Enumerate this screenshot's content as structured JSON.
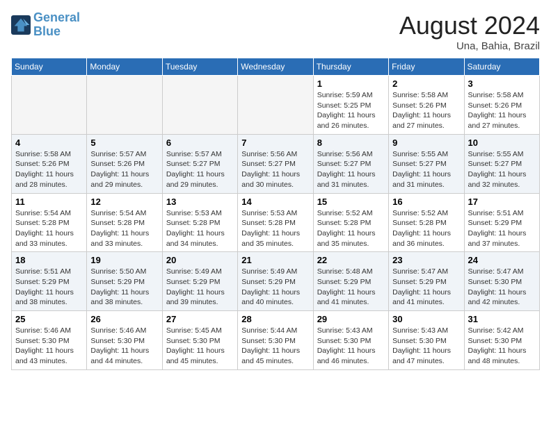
{
  "header": {
    "logo_line1": "General",
    "logo_line2": "Blue",
    "month_year": "August 2024",
    "location": "Una, Bahia, Brazil"
  },
  "days_of_week": [
    "Sunday",
    "Monday",
    "Tuesday",
    "Wednesday",
    "Thursday",
    "Friday",
    "Saturday"
  ],
  "weeks": [
    {
      "row_class": "row-odd",
      "days": [
        {
          "num": "",
          "empty": true,
          "info": ""
        },
        {
          "num": "",
          "empty": true,
          "info": ""
        },
        {
          "num": "",
          "empty": true,
          "info": ""
        },
        {
          "num": "",
          "empty": true,
          "info": ""
        },
        {
          "num": "1",
          "empty": false,
          "info": "Sunrise: 5:59 AM\nSunset: 5:25 PM\nDaylight: 11 hours\nand 26 minutes."
        },
        {
          "num": "2",
          "empty": false,
          "info": "Sunrise: 5:58 AM\nSunset: 5:26 PM\nDaylight: 11 hours\nand 27 minutes."
        },
        {
          "num": "3",
          "empty": false,
          "info": "Sunrise: 5:58 AM\nSunset: 5:26 PM\nDaylight: 11 hours\nand 27 minutes."
        }
      ]
    },
    {
      "row_class": "row-even",
      "days": [
        {
          "num": "4",
          "empty": false,
          "info": "Sunrise: 5:58 AM\nSunset: 5:26 PM\nDaylight: 11 hours\nand 28 minutes."
        },
        {
          "num": "5",
          "empty": false,
          "info": "Sunrise: 5:57 AM\nSunset: 5:26 PM\nDaylight: 11 hours\nand 29 minutes."
        },
        {
          "num": "6",
          "empty": false,
          "info": "Sunrise: 5:57 AM\nSunset: 5:27 PM\nDaylight: 11 hours\nand 29 minutes."
        },
        {
          "num": "7",
          "empty": false,
          "info": "Sunrise: 5:56 AM\nSunset: 5:27 PM\nDaylight: 11 hours\nand 30 minutes."
        },
        {
          "num": "8",
          "empty": false,
          "info": "Sunrise: 5:56 AM\nSunset: 5:27 PM\nDaylight: 11 hours\nand 31 minutes."
        },
        {
          "num": "9",
          "empty": false,
          "info": "Sunrise: 5:55 AM\nSunset: 5:27 PM\nDaylight: 11 hours\nand 31 minutes."
        },
        {
          "num": "10",
          "empty": false,
          "info": "Sunrise: 5:55 AM\nSunset: 5:27 PM\nDaylight: 11 hours\nand 32 minutes."
        }
      ]
    },
    {
      "row_class": "row-odd",
      "days": [
        {
          "num": "11",
          "empty": false,
          "info": "Sunrise: 5:54 AM\nSunset: 5:28 PM\nDaylight: 11 hours\nand 33 minutes."
        },
        {
          "num": "12",
          "empty": false,
          "info": "Sunrise: 5:54 AM\nSunset: 5:28 PM\nDaylight: 11 hours\nand 33 minutes."
        },
        {
          "num": "13",
          "empty": false,
          "info": "Sunrise: 5:53 AM\nSunset: 5:28 PM\nDaylight: 11 hours\nand 34 minutes."
        },
        {
          "num": "14",
          "empty": false,
          "info": "Sunrise: 5:53 AM\nSunset: 5:28 PM\nDaylight: 11 hours\nand 35 minutes."
        },
        {
          "num": "15",
          "empty": false,
          "info": "Sunrise: 5:52 AM\nSunset: 5:28 PM\nDaylight: 11 hours\nand 35 minutes."
        },
        {
          "num": "16",
          "empty": false,
          "info": "Sunrise: 5:52 AM\nSunset: 5:28 PM\nDaylight: 11 hours\nand 36 minutes."
        },
        {
          "num": "17",
          "empty": false,
          "info": "Sunrise: 5:51 AM\nSunset: 5:29 PM\nDaylight: 11 hours\nand 37 minutes."
        }
      ]
    },
    {
      "row_class": "row-even",
      "days": [
        {
          "num": "18",
          "empty": false,
          "info": "Sunrise: 5:51 AM\nSunset: 5:29 PM\nDaylight: 11 hours\nand 38 minutes."
        },
        {
          "num": "19",
          "empty": false,
          "info": "Sunrise: 5:50 AM\nSunset: 5:29 PM\nDaylight: 11 hours\nand 38 minutes."
        },
        {
          "num": "20",
          "empty": false,
          "info": "Sunrise: 5:49 AM\nSunset: 5:29 PM\nDaylight: 11 hours\nand 39 minutes."
        },
        {
          "num": "21",
          "empty": false,
          "info": "Sunrise: 5:49 AM\nSunset: 5:29 PM\nDaylight: 11 hours\nand 40 minutes."
        },
        {
          "num": "22",
          "empty": false,
          "info": "Sunrise: 5:48 AM\nSunset: 5:29 PM\nDaylight: 11 hours\nand 41 minutes."
        },
        {
          "num": "23",
          "empty": false,
          "info": "Sunrise: 5:47 AM\nSunset: 5:29 PM\nDaylight: 11 hours\nand 41 minutes."
        },
        {
          "num": "24",
          "empty": false,
          "info": "Sunrise: 5:47 AM\nSunset: 5:30 PM\nDaylight: 11 hours\nand 42 minutes."
        }
      ]
    },
    {
      "row_class": "row-odd",
      "days": [
        {
          "num": "25",
          "empty": false,
          "info": "Sunrise: 5:46 AM\nSunset: 5:30 PM\nDaylight: 11 hours\nand 43 minutes."
        },
        {
          "num": "26",
          "empty": false,
          "info": "Sunrise: 5:46 AM\nSunset: 5:30 PM\nDaylight: 11 hours\nand 44 minutes."
        },
        {
          "num": "27",
          "empty": false,
          "info": "Sunrise: 5:45 AM\nSunset: 5:30 PM\nDaylight: 11 hours\nand 45 minutes."
        },
        {
          "num": "28",
          "empty": false,
          "info": "Sunrise: 5:44 AM\nSunset: 5:30 PM\nDaylight: 11 hours\nand 45 minutes."
        },
        {
          "num": "29",
          "empty": false,
          "info": "Sunrise: 5:43 AM\nSunset: 5:30 PM\nDaylight: 11 hours\nand 46 minutes."
        },
        {
          "num": "30",
          "empty": false,
          "info": "Sunrise: 5:43 AM\nSunset: 5:30 PM\nDaylight: 11 hours\nand 47 minutes."
        },
        {
          "num": "31",
          "empty": false,
          "info": "Sunrise: 5:42 AM\nSunset: 5:30 PM\nDaylight: 11 hours\nand 48 minutes."
        }
      ]
    }
  ]
}
